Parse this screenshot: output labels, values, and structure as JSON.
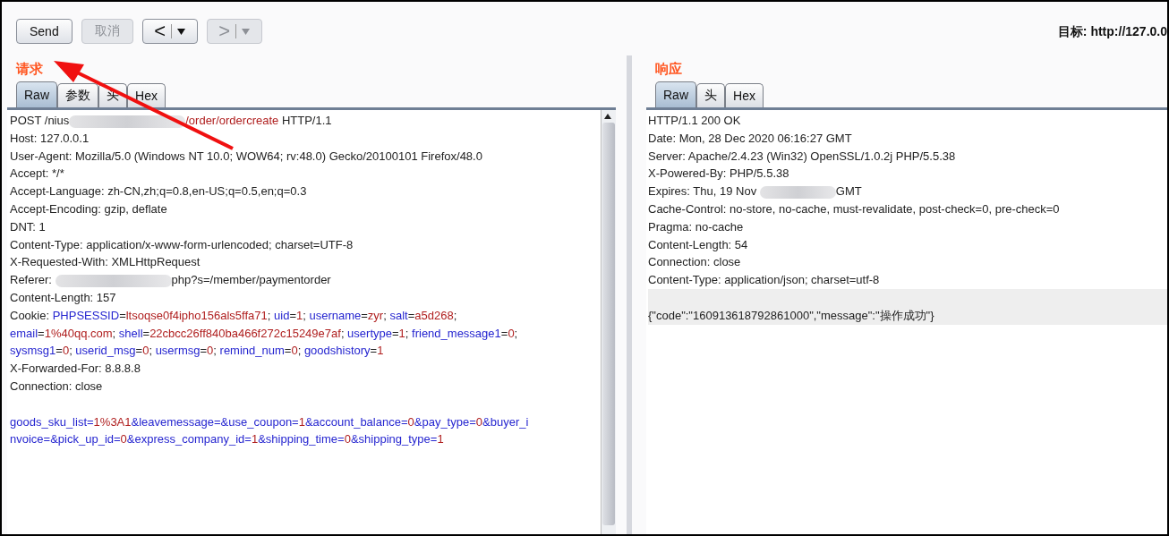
{
  "toolbar": {
    "buttons": [
      {
        "label": "Send",
        "kind": "text",
        "disabled": false
      },
      {
        "label": "取消",
        "kind": "text",
        "disabled": true
      },
      {
        "label": "<",
        "kind": "nav",
        "disabled": false
      },
      {
        "label": ">",
        "kind": "nav",
        "disabled": true
      }
    ],
    "target_label": "目标:",
    "target_url": "http://127.0.0"
  },
  "request": {
    "title": "请求",
    "tabs": [
      {
        "label": "Raw",
        "selected": true
      },
      {
        "label": "参数",
        "selected": false
      },
      {
        "label": "头",
        "selected": false
      },
      {
        "label": "Hex",
        "selected": false
      }
    ],
    "lines": [
      {
        "gap_before": false,
        "segments": [
          {
            "text": "POST /nius",
            "kind": "plain"
          },
          {
            "kind": "blur"
          },
          {
            "text": "/order/ordercreate",
            "kind": "value"
          },
          {
            "text": " HTTP/1.1",
            "kind": "plain"
          }
        ]
      },
      {
        "gap_before": false,
        "segments": [
          {
            "text": "Host: 127.0.0.1",
            "kind": "plain"
          }
        ]
      },
      {
        "gap_before": false,
        "segments": [
          {
            "text": "User-Agent: Mozilla/5.0 (Windows NT 10.0; WOW64; rv:48.0) Gecko/20100101 Firefox/48.0",
            "kind": "plain"
          }
        ]
      },
      {
        "gap_before": false,
        "segments": [
          {
            "text": "Accept: */*",
            "kind": "plain"
          }
        ]
      },
      {
        "gap_before": false,
        "segments": [
          {
            "text": "Accept-Language: zh-CN,zh;q=0.8,en-US;q=0.5,en;q=0.3",
            "kind": "plain"
          }
        ]
      },
      {
        "gap_before": false,
        "segments": [
          {
            "text": "Accept-Encoding: gzip, deflate",
            "kind": "plain"
          }
        ]
      },
      {
        "gap_before": false,
        "segments": [
          {
            "text": "DNT: 1",
            "kind": "plain"
          }
        ]
      },
      {
        "gap_before": false,
        "segments": [
          {
            "text": "Content-Type: application/x-www-form-urlencoded; charset=UTF-8",
            "kind": "plain"
          }
        ]
      },
      {
        "gap_before": false,
        "segments": [
          {
            "text": "X-Requested-With: XMLHttpRequest",
            "kind": "plain"
          }
        ]
      },
      {
        "gap_before": false,
        "segments": [
          {
            "text": "Referer: ",
            "kind": "plain"
          },
          {
            "kind": "blur"
          },
          {
            "text": "php?s=/member/paymentorder",
            "kind": "plain"
          }
        ]
      },
      {
        "gap_before": false,
        "segments": [
          {
            "text": "Content-Length: 157",
            "kind": "plain"
          }
        ]
      },
      {
        "gap_before": false,
        "segments": [
          {
            "text": "Cookie: ",
            "kind": "plain"
          },
          {
            "text": "PHPSESSID",
            "kind": "key"
          },
          {
            "text": "=",
            "kind": "plain"
          },
          {
            "text": "ltsoqse0f4ipho156als5ffa71",
            "kind": "value"
          },
          {
            "text": "; ",
            "kind": "plain"
          },
          {
            "text": "uid",
            "kind": "key"
          },
          {
            "text": "=",
            "kind": "plain"
          },
          {
            "text": "1",
            "kind": "value"
          },
          {
            "text": "; ",
            "kind": "plain"
          },
          {
            "text": "username",
            "kind": "key"
          },
          {
            "text": "=",
            "kind": "plain"
          },
          {
            "text": "zyr",
            "kind": "value"
          },
          {
            "text": "; ",
            "kind": "plain"
          },
          {
            "text": "salt",
            "kind": "key"
          },
          {
            "text": "=",
            "kind": "plain"
          },
          {
            "text": "a5d268",
            "kind": "value"
          },
          {
            "text": ";",
            "kind": "plain"
          }
        ]
      },
      {
        "gap_before": false,
        "segments": [
          {
            "text": "email",
            "kind": "key"
          },
          {
            "text": "=",
            "kind": "plain"
          },
          {
            "text": "1%40qq.com",
            "kind": "value"
          },
          {
            "text": "; ",
            "kind": "plain"
          },
          {
            "text": "shell",
            "kind": "key"
          },
          {
            "text": "=",
            "kind": "plain"
          },
          {
            "text": "22cbcc26ff840ba466f272c15249e7af",
            "kind": "value"
          },
          {
            "text": "; ",
            "kind": "plain"
          },
          {
            "text": "usertype",
            "kind": "key"
          },
          {
            "text": "=",
            "kind": "plain"
          },
          {
            "text": "1",
            "kind": "value"
          },
          {
            "text": "; ",
            "kind": "plain"
          },
          {
            "text": "friend_message1",
            "kind": "key"
          },
          {
            "text": "=",
            "kind": "plain"
          },
          {
            "text": "0",
            "kind": "value"
          },
          {
            "text": ";",
            "kind": "plain"
          }
        ]
      },
      {
        "gap_before": false,
        "segments": [
          {
            "text": "sysmsg1",
            "kind": "key"
          },
          {
            "text": "=",
            "kind": "plain"
          },
          {
            "text": "0",
            "kind": "value"
          },
          {
            "text": "; ",
            "kind": "plain"
          },
          {
            "text": "userid_msg",
            "kind": "key"
          },
          {
            "text": "=",
            "kind": "plain"
          },
          {
            "text": "0",
            "kind": "value"
          },
          {
            "text": "; ",
            "kind": "plain"
          },
          {
            "text": "usermsg",
            "kind": "key"
          },
          {
            "text": "=",
            "kind": "plain"
          },
          {
            "text": "0",
            "kind": "value"
          },
          {
            "text": "; ",
            "kind": "plain"
          },
          {
            "text": "remind_num",
            "kind": "key"
          },
          {
            "text": "=",
            "kind": "plain"
          },
          {
            "text": "0",
            "kind": "value"
          },
          {
            "text": "; ",
            "kind": "plain"
          },
          {
            "text": "goodshistory",
            "kind": "key"
          },
          {
            "text": "=",
            "kind": "plain"
          },
          {
            "text": "1",
            "kind": "value"
          }
        ]
      },
      {
        "gap_before": false,
        "segments": [
          {
            "text": "X-Forwarded-For: 8.8.8.8",
            "kind": "plain"
          }
        ]
      },
      {
        "gap_before": false,
        "segments": [
          {
            "text": "Connection: close",
            "kind": "plain"
          }
        ]
      },
      {
        "gap_before": true,
        "segments": [
          {
            "text": "goods_sku_list",
            "kind": "key"
          },
          {
            "text": "=",
            "kind": "key"
          },
          {
            "text": "1%3A1",
            "kind": "value"
          },
          {
            "text": "&leavemessage=&use_coupon=",
            "kind": "key"
          },
          {
            "text": "1",
            "kind": "value"
          },
          {
            "text": "&account_balance=",
            "kind": "key"
          },
          {
            "text": "0",
            "kind": "value"
          },
          {
            "text": "&pay_type=",
            "kind": "key"
          },
          {
            "text": "0",
            "kind": "value"
          },
          {
            "text": "&buyer_i",
            "kind": "key"
          }
        ]
      },
      {
        "gap_before": false,
        "segments": [
          {
            "text": "nvoice=&pick_up_id=",
            "kind": "key"
          },
          {
            "text": "0",
            "kind": "value"
          },
          {
            "text": "&express_company_id=",
            "kind": "key"
          },
          {
            "text": "1",
            "kind": "value"
          },
          {
            "text": "&shipping_time=",
            "kind": "key"
          },
          {
            "text": "0",
            "kind": "value"
          },
          {
            "text": "&shipping_type=",
            "kind": "key"
          },
          {
            "text": "1",
            "kind": "value"
          }
        ]
      }
    ]
  },
  "response": {
    "title": "响应",
    "tabs": [
      {
        "label": "Raw",
        "selected": true
      },
      {
        "label": "头",
        "selected": false
      },
      {
        "label": "Hex",
        "selected": false
      }
    ],
    "lines": [
      {
        "gap_before": false,
        "segments": [
          {
            "text": "HTTP/1.1 200 OK",
            "kind": "plain"
          }
        ]
      },
      {
        "gap_before": false,
        "segments": [
          {
            "text": "Date: Mon, 28 Dec 2020 06:16:27 GMT",
            "kind": "plain"
          }
        ]
      },
      {
        "gap_before": false,
        "segments": [
          {
            "text": "Server: Apache/2.4.23 (Win32) OpenSSL/1.0.2j PHP/5.5.38",
            "kind": "plain"
          }
        ]
      },
      {
        "gap_before": false,
        "segments": [
          {
            "text": "X-Powered-By: PHP/5.5.38",
            "kind": "plain"
          }
        ]
      },
      {
        "gap_before": false,
        "segments": [
          {
            "text": "Expires: Thu, 19 Nov ",
            "kind": "plain"
          },
          {
            "kind": "blur"
          },
          {
            "text": "GMT",
            "kind": "plain"
          }
        ]
      },
      {
        "gap_before": false,
        "segments": [
          {
            "text": "Cache-Control: no-store, no-cache, must-revalidate, post-check=0, pre-check=0",
            "kind": "plain"
          }
        ]
      },
      {
        "gap_before": false,
        "segments": [
          {
            "text": "Pragma: no-cache",
            "kind": "plain"
          }
        ]
      },
      {
        "gap_before": false,
        "segments": [
          {
            "text": "Content-Length: 54",
            "kind": "plain"
          }
        ]
      },
      {
        "gap_before": false,
        "segments": [
          {
            "text": "Connection: close",
            "kind": "plain"
          }
        ]
      },
      {
        "gap_before": false,
        "segments": [
          {
            "text": "Content-Type: application/json; charset=utf-8",
            "kind": "plain"
          }
        ]
      },
      {
        "gap_before": true,
        "segments": [
          {
            "text": "{\"code\":\"160913618792861000\",\"message\":\"操作成功\"}",
            "kind": "highlight"
          }
        ]
      }
    ]
  }
}
